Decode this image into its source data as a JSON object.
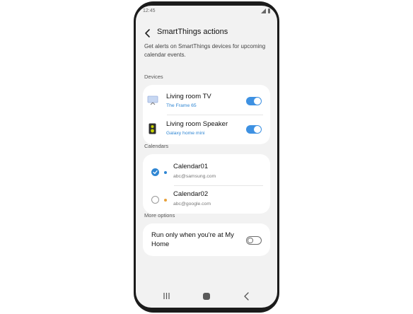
{
  "status_bar": {
    "time": "12:45"
  },
  "header": {
    "title": "SmartThings actions",
    "description": "Get alerts on SmartThings devices for upcoming calendar events."
  },
  "devices": {
    "label": "Devices",
    "items": [
      {
        "name": "Living room TV",
        "model": "The Frame 65",
        "enabled": true
      },
      {
        "name": "Living room Speaker",
        "model": "Galaxy home mini",
        "enabled": true
      }
    ]
  },
  "calendars": {
    "label": "Calendars",
    "items": [
      {
        "name": "Calendar01",
        "account": "abc@samsung.com",
        "checked": true,
        "color": "#2f86d3"
      },
      {
        "name": "Calendar02",
        "account": "abc@google.com",
        "checked": false,
        "color": "#e8a13a"
      }
    ]
  },
  "more_options": {
    "label": "More options",
    "run_at_home": {
      "label": "Run only when you're at My Home",
      "enabled": false
    }
  },
  "colors": {
    "accent": "#3e91e2",
    "link": "#2f86d3",
    "background": "#f2f2f2"
  }
}
